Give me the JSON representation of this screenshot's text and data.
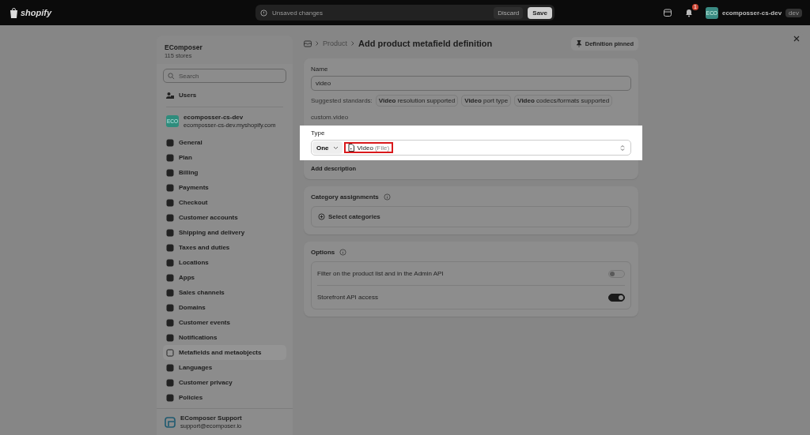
{
  "top_bar": {
    "logo": "shopify",
    "status": "Unsaved changes",
    "discard": "Discard",
    "save": "Save",
    "notification_count": "1",
    "store_avatar": "ECO",
    "store_name": "ecomposser-cs-dev",
    "store_tag": "dev"
  },
  "sidebar": {
    "org_name": "EComposer",
    "org_count": "115 stores",
    "search": {
      "placeholder": "Search"
    },
    "users": "Users",
    "store_avatar": "ECO",
    "store_name": "ecomposser-cs-dev",
    "store_url": "ecomposser-cs-dev.myshopify.com",
    "items": [
      {
        "label": "General",
        "selected": false
      },
      {
        "label": "Plan",
        "selected": false
      },
      {
        "label": "Billing",
        "selected": false
      },
      {
        "label": "Payments",
        "selected": false
      },
      {
        "label": "Checkout",
        "selected": false
      },
      {
        "label": "Customer accounts",
        "selected": false
      },
      {
        "label": "Shipping and delivery",
        "selected": false
      },
      {
        "label": "Taxes and duties",
        "selected": false
      },
      {
        "label": "Locations",
        "selected": false
      },
      {
        "label": "Apps",
        "selected": false
      },
      {
        "label": "Sales channels",
        "selected": false
      },
      {
        "label": "Domains",
        "selected": false
      },
      {
        "label": "Customer events",
        "selected": false
      },
      {
        "label": "Notifications",
        "selected": false
      },
      {
        "label": "Metafields and metaobjects",
        "selected": true
      },
      {
        "label": "Languages",
        "selected": false
      },
      {
        "label": "Customer privacy",
        "selected": false
      },
      {
        "label": "Policies",
        "selected": false
      }
    ],
    "footer_title": "EComposer Support",
    "footer_email": "support@ecomposer.io"
  },
  "page": {
    "breadcrumb": "Product",
    "title": "Add product metafield definition",
    "pinned": "Definition pinned",
    "name_label": "Name",
    "name_value": "video",
    "suggested_label": "Suggested standards:",
    "suggestions": [
      "**Video** resolution supported",
      "**Video** port type",
      "**Video** codecs/formats supported"
    ],
    "namespace": "custom.video",
    "type_label": "Type",
    "list_mode": "One",
    "type_name": "Video",
    "type_detail": "(File)",
    "add_description": "Add description",
    "category_title": "Category assignments",
    "select_categories": "Select categories",
    "options_title": "Options",
    "options": [
      {
        "label": "Filter on the product list and in the Admin API",
        "on": false
      },
      {
        "label": "Storefront API access",
        "on": true
      }
    ]
  }
}
